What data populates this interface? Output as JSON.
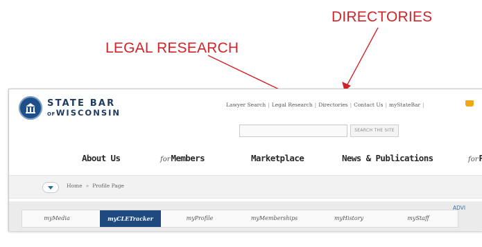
{
  "callouts": {
    "directories": "DIRECTORIES",
    "legal_research": "LEGAL RESEARCH"
  },
  "colors": {
    "callout_red": "#d2232a",
    "brand_navy": "#1f3b60",
    "active_tab": "#1e4a80",
    "cart_orange": "#f0a818"
  },
  "logo": {
    "line1": "STATE BAR",
    "of": "OF",
    "line2": "WISCONSIN",
    "icon": "capitol-seal-icon"
  },
  "utility_nav": {
    "items": [
      "Lawyer Search",
      "Legal Research",
      "Directories",
      "Contact Us",
      "myStateBar"
    ],
    "separator": "|",
    "cart_icon": "cart-icon"
  },
  "search": {
    "placeholder": "",
    "button_label": "SEARCH THE SITE"
  },
  "main_nav": {
    "items": [
      {
        "prefix": "",
        "label": "About Us"
      },
      {
        "prefix": "for",
        "label": "Members"
      },
      {
        "prefix": "",
        "label": "Marketplace"
      },
      {
        "prefix": "",
        "label": "News & Publications"
      },
      {
        "prefix": "for",
        "label": "P"
      }
    ]
  },
  "breadcrumb": {
    "toggle_icon": "chevron-down-icon",
    "items": [
      "Home",
      "Profile Page"
    ],
    "separator": "»"
  },
  "sub_nav": {
    "tabs": [
      "myMedia",
      "myCLETracker",
      "myProfile",
      "myMemberships",
      "myHistory",
      "myStaff"
    ],
    "active": "myCLETracker",
    "right_link": "ADVI"
  }
}
